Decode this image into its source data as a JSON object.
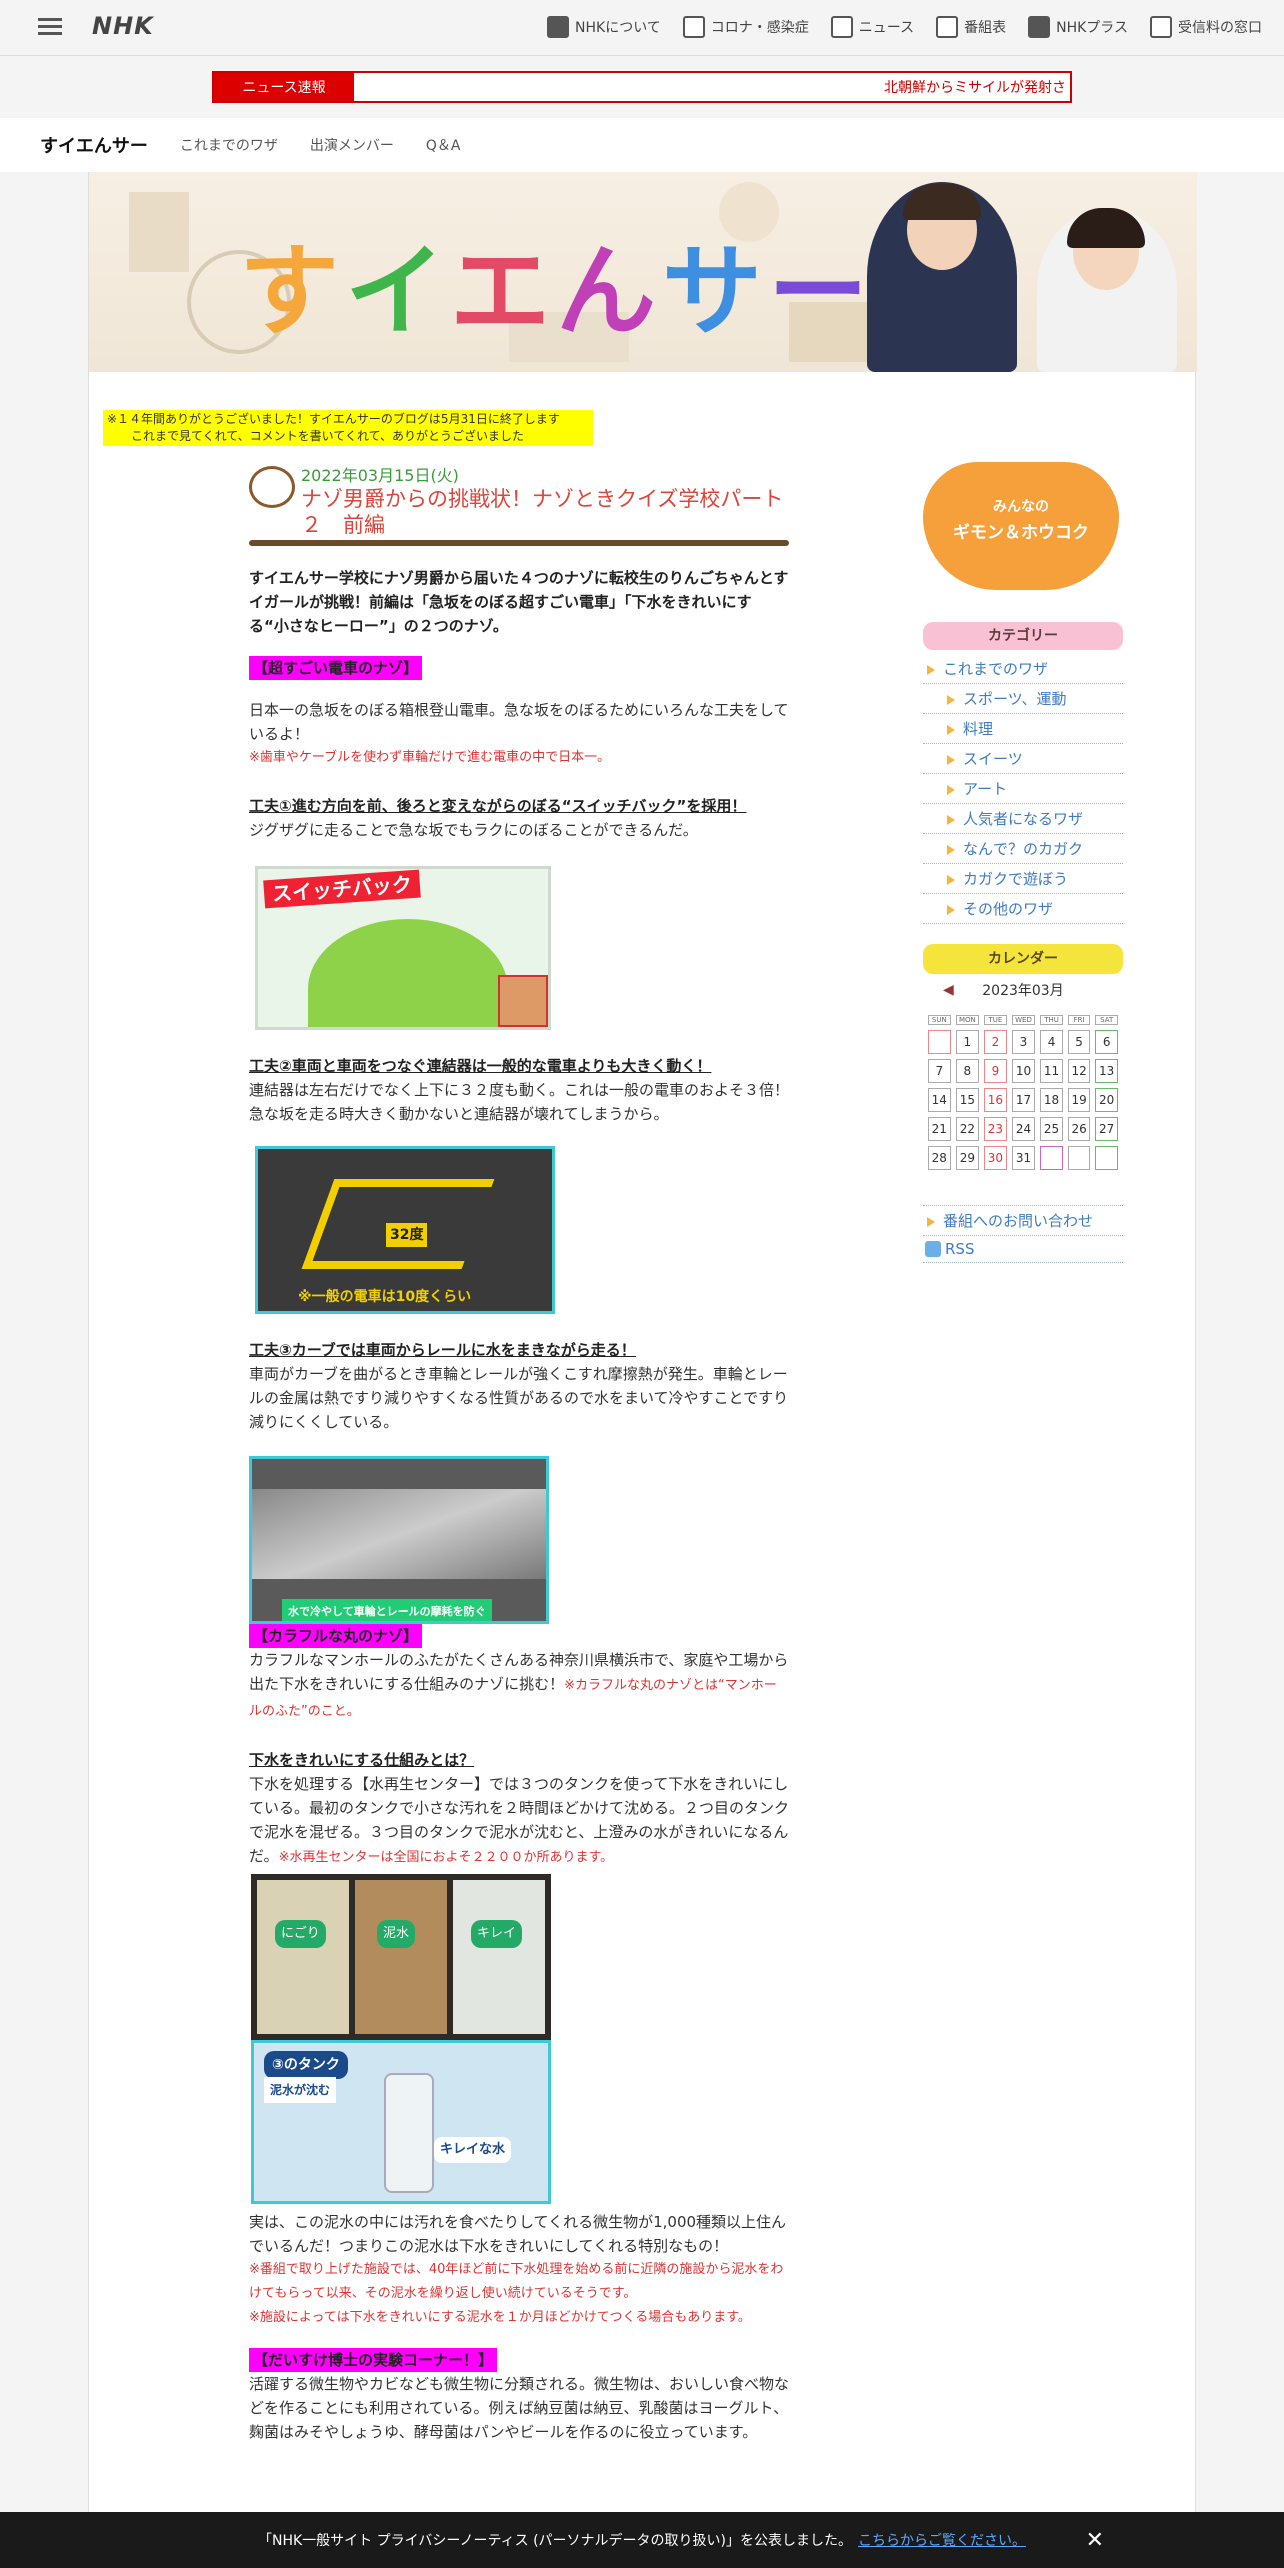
{
  "header": {
    "logo": "NHK",
    "nav": [
      {
        "label": "NHKについて",
        "icon": "nhk-box-icon"
      },
      {
        "label": "コロナ・感染症",
        "icon": "virus-doc-icon"
      },
      {
        "label": "ニュース",
        "icon": "news-icon"
      },
      {
        "label": "番組表",
        "icon": "grid-icon"
      },
      {
        "label": "NHKプラス",
        "icon": "plus-icon"
      },
      {
        "label": "受信料の窓口",
        "icon": "window-icon"
      }
    ]
  },
  "news": {
    "label": "ニュース速報",
    "text": "北朝鮮からミサイルが発射さ"
  },
  "subnav": {
    "brand": "すイエんサー",
    "links": [
      "これまでのワザ",
      "出演メンバー",
      "Q＆A"
    ]
  },
  "banner": {
    "title_chars": [
      "す",
      "イ",
      "エ",
      "ん",
      "サ",
      "ー"
    ]
  },
  "notice": {
    "line1": "※１４年間ありがとうございました！すイエんサーのブログは5月31日に終了します",
    "line2": "これまで見てくれて、コメントを書いてくれて、ありがとうございました"
  },
  "article": {
    "date": "2022年03月15日(火)",
    "title": "ナゾ男爵からの挑戦状！ナゾときクイズ学校パート２　前編",
    "lead": "すイエんサー学校にナゾ男爵から届いた４つのナゾに転校生のりんごちゃんとすイガールが挑戦！前編は「急坂をのぼる超すごい電車」「下水をきれいにする“小さなヒーロー”」の２つのナゾ。",
    "sec1": "【超すごい電車のナゾ】",
    "p1": "日本一の急坂をのぼる箱根登山電車。急な坂をのぼるためにいろんな工夫をしているよ！",
    "n1": "※歯車やケーブルを使わず車輪だけで進む電車の中で日本一。",
    "h1": "工夫①進む方向を前、後ろと変えながらのぼる“スイッチバック”を採用！",
    "p2": "ジグザグに走ることで急な坂でもラクにのぼることができるんだ。",
    "img1": "スイッチバック",
    "h2": "工夫②車両と車両をつなぐ連結器は一般的な電車よりも大きく動く！",
    "p3": "連結器は左右だけでなく上下に３２度も動く。これは一般の電車のおよそ３倍！急な坂を走る時大きく動かないと連結器が壊れてしまうから。",
    "img2a": "32度",
    "img2b": "※一般の電車は10度くらい",
    "h3": "工夫③カーブでは車両からレールに水をまきながら走る！",
    "p4": "車両がカーブを曲がるとき車輪とレールが強くこすれ摩擦熱が発生。車輪とレールの金属は熱ですり減りやすくなる性質があるので水をまいて冷やすことですり減りにくくしている。",
    "img3": "水で冷やして車輪とレールの摩耗を防ぐ",
    "sec2": "【カラフルな丸のナゾ】",
    "p5": "カラフルなマンホールのふたがたくさんある神奈川県横浜市で、家庭や工場から出た下水をきれいにする仕組みのナゾに挑む！",
    "n5": "※カラフルな丸のナゾとは“マンホールのふた”のこと。",
    "h4": "下水をきれいにする仕組みとは？",
    "p6": "下水を処理する【水再生センター】では３つのタンクを使って下水をきれいにしている。最初のタンクで小さな汚れを２時間ほどかけて沈める。２つ目のタンクで泥水を混ぜる。３つ目のタンクで泥水が沈むと、上澄みの水がきれいになるんだ。",
    "n6": "※水再生センターは全国におよそ２２００か所あります。",
    "img4": [
      "にごり",
      "泥水",
      "キレイ"
    ],
    "img5a": "③のタンク",
    "img5b": "泥水が沈む",
    "img5c": "キレイな水",
    "p7": "実は、この泥水の中には汚れを食べたりしてくれる微生物が1,000種類以上住んでいるんだ！つまりこの泥水は下水をきれいにしてくれる特別なもの！",
    "n7a": "※番組で取り上げた施設では、40年ほど前に下水処理を始める前に近隣の施設から泥水をわけてもらって以来、その泥水を繰り返し使い続けているそうです。",
    "n7b": "※施設によっては下水をきれいにする泥水を１か月ほどかけてつくる場合もあります。",
    "sec3": "【だいすけ博士の実験コーナー！】",
    "p8": "活躍する微生物やカビなども微生物に分類される。微生物は、おいしい食べ物などを作ることにも利用されている。例えば納豆菌は納豆、乳酸菌はヨーグルト、麹菌はみそやしょうゆ、酵母菌はパンやビールを作るのに役立っています。"
  },
  "sidebar": {
    "gimon": [
      "みんなの",
      "ギモン＆ホウコク"
    ],
    "category_label": "カテゴリー",
    "categories": [
      {
        "label": "これまでのワザ",
        "sub": false
      },
      {
        "label": "スポーツ、運動",
        "sub": true
      },
      {
        "label": "料理",
        "sub": true
      },
      {
        "label": "スイーツ",
        "sub": true
      },
      {
        "label": "アート",
        "sub": true
      },
      {
        "label": "人気者になるワザ",
        "sub": true
      },
      {
        "label": "なんで？のカガク",
        "sub": true
      },
      {
        "label": "カガクで遊ぼう",
        "sub": true
      },
      {
        "label": "その他のワザ",
        "sub": true
      }
    ],
    "calendar_label": "カレンダー",
    "month": "2023年03月",
    "weekdays": [
      "SUN",
      "MON",
      "TUE",
      "WED",
      "THU",
      "FRI",
      "SAT"
    ],
    "weeks": [
      [
        "",
        "1",
        "2",
        "3",
        "4",
        "5",
        "6"
      ],
      [
        "7",
        "8",
        "9",
        "10",
        "11",
        "12",
        "13"
      ],
      [
        "14",
        "15",
        "16",
        "17",
        "18",
        "19",
        "20"
      ],
      [
        "21",
        "22",
        "23",
        "24",
        "25",
        "26",
        "27"
      ],
      [
        "28",
        "29",
        "30",
        "31",
        "",
        "",
        ""
      ]
    ],
    "contact": "番組へのお問い合わせ",
    "rss": "RSS"
  },
  "cookie": {
    "text": "「NHK一般サイト プライバシーノーティス (パーソナルデータの取り扱い)」を公表しました。",
    "link": "こちらからご覧ください。"
  }
}
